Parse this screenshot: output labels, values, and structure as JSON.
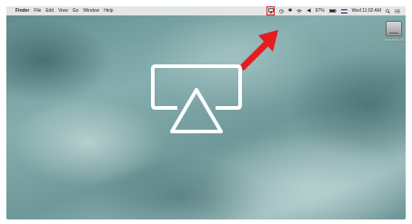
{
  "menubar": {
    "apple_icon": "",
    "app_name": "Finder",
    "menus": [
      "File",
      "Edit",
      "View",
      "Go",
      "Window",
      "Help"
    ],
    "status_icons": [
      "airplay-icon",
      "time-machine-icon",
      "bluetooth-icon",
      "wifi-icon",
      "volume-icon"
    ],
    "battery": "97%",
    "flag_icon": "us-flag-icon",
    "clock": "Wed 11:02 AM",
    "search_icon": "search-icon",
    "list_icon": "notification-list-icon"
  },
  "desktop": {
    "drive_label": "Macintosh HD",
    "annotation_color": "#e41e1e",
    "big_icon": "airplay-icon"
  }
}
